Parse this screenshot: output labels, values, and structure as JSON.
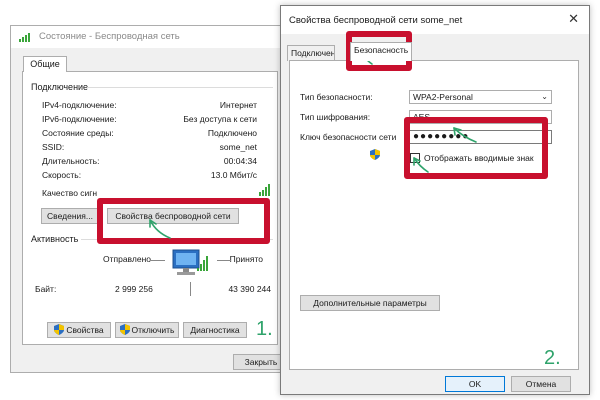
{
  "window1": {
    "title": "Состояние - Беспроводная сеть",
    "tab_general": "Общие",
    "group_connection": "Подключение",
    "rows": [
      {
        "label": "IPv4-подключение:",
        "value": "Интернет"
      },
      {
        "label": "IPv6-подключение:",
        "value": "Без доступа к сети"
      },
      {
        "label": "Состояние среды:",
        "value": "Подключено"
      },
      {
        "label": "SSID:",
        "value": "some_net"
      },
      {
        "label": "Длительность:",
        "value": "00:04:34"
      },
      {
        "label": "Скорость:",
        "value": "13.0 Мбит/с"
      }
    ],
    "signal_quality_label": "Качество сигн",
    "details_button": "Сведения...",
    "wireless_props_button": "Свойства беспроводной сети",
    "group_activity": "Активность",
    "sent_label": "Отправлено",
    "received_label": "Принято",
    "bytes_label": "Байт:",
    "bytes_sent": "2 999 256",
    "bytes_received": "43 390 244",
    "properties_button": "Свойства",
    "disable_button": "Отключить",
    "diagnose_button": "Диагностика",
    "close_button": "Закрыть"
  },
  "window2": {
    "title": "Свойства беспроводной сети some_net",
    "close_glyph": "✕",
    "tab_connection": "Подключени",
    "tab_security": "Безопасность",
    "security_type_label": "Тип безопасности:",
    "security_type_value": "WPA2-Personal",
    "encryption_type_label": "Тип шифрования:",
    "encryption_type_value": "AES",
    "security_key_label": "Ключ безопасности сети",
    "security_key_value": "●●●●●●●●",
    "show_chars_label": "Отображать вводимые знак",
    "show_chars_checked": false,
    "advanced_button": "Дополнительные параметры",
    "ok_button": "OK",
    "cancel_button": "Отмена"
  },
  "annotations": {
    "step1": "1.",
    "step2": "2.",
    "highlight_color": "#c8102e",
    "arrow_color": "#2fa36b"
  }
}
